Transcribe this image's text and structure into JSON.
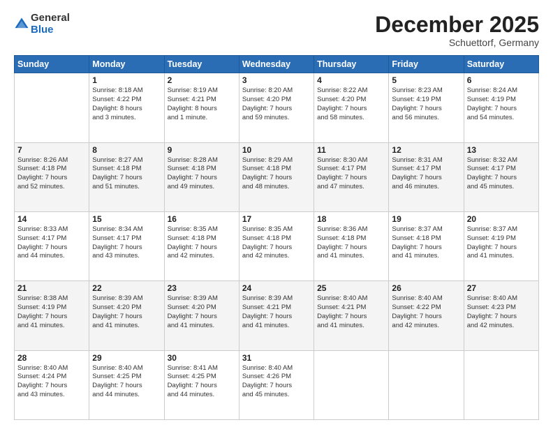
{
  "logo": {
    "general": "General",
    "blue": "Blue"
  },
  "header": {
    "month": "December 2025",
    "location": "Schuettorf, Germany"
  },
  "days_of_week": [
    "Sunday",
    "Monday",
    "Tuesday",
    "Wednesday",
    "Thursday",
    "Friday",
    "Saturday"
  ],
  "weeks": [
    [
      {
        "day": "",
        "info": ""
      },
      {
        "day": "1",
        "info": "Sunrise: 8:18 AM\nSunset: 4:22 PM\nDaylight: 8 hours\nand 3 minutes."
      },
      {
        "day": "2",
        "info": "Sunrise: 8:19 AM\nSunset: 4:21 PM\nDaylight: 8 hours\nand 1 minute."
      },
      {
        "day": "3",
        "info": "Sunrise: 8:20 AM\nSunset: 4:20 PM\nDaylight: 7 hours\nand 59 minutes."
      },
      {
        "day": "4",
        "info": "Sunrise: 8:22 AM\nSunset: 4:20 PM\nDaylight: 7 hours\nand 58 minutes."
      },
      {
        "day": "5",
        "info": "Sunrise: 8:23 AM\nSunset: 4:19 PM\nDaylight: 7 hours\nand 56 minutes."
      },
      {
        "day": "6",
        "info": "Sunrise: 8:24 AM\nSunset: 4:19 PM\nDaylight: 7 hours\nand 54 minutes."
      }
    ],
    [
      {
        "day": "7",
        "info": "Sunrise: 8:26 AM\nSunset: 4:18 PM\nDaylight: 7 hours\nand 52 minutes."
      },
      {
        "day": "8",
        "info": "Sunrise: 8:27 AM\nSunset: 4:18 PM\nDaylight: 7 hours\nand 51 minutes."
      },
      {
        "day": "9",
        "info": "Sunrise: 8:28 AM\nSunset: 4:18 PM\nDaylight: 7 hours\nand 49 minutes."
      },
      {
        "day": "10",
        "info": "Sunrise: 8:29 AM\nSunset: 4:18 PM\nDaylight: 7 hours\nand 48 minutes."
      },
      {
        "day": "11",
        "info": "Sunrise: 8:30 AM\nSunset: 4:17 PM\nDaylight: 7 hours\nand 47 minutes."
      },
      {
        "day": "12",
        "info": "Sunrise: 8:31 AM\nSunset: 4:17 PM\nDaylight: 7 hours\nand 46 minutes."
      },
      {
        "day": "13",
        "info": "Sunrise: 8:32 AM\nSunset: 4:17 PM\nDaylight: 7 hours\nand 45 minutes."
      }
    ],
    [
      {
        "day": "14",
        "info": "Sunrise: 8:33 AM\nSunset: 4:17 PM\nDaylight: 7 hours\nand 44 minutes."
      },
      {
        "day": "15",
        "info": "Sunrise: 8:34 AM\nSunset: 4:17 PM\nDaylight: 7 hours\nand 43 minutes."
      },
      {
        "day": "16",
        "info": "Sunrise: 8:35 AM\nSunset: 4:18 PM\nDaylight: 7 hours\nand 42 minutes."
      },
      {
        "day": "17",
        "info": "Sunrise: 8:35 AM\nSunset: 4:18 PM\nDaylight: 7 hours\nand 42 minutes."
      },
      {
        "day": "18",
        "info": "Sunrise: 8:36 AM\nSunset: 4:18 PM\nDaylight: 7 hours\nand 41 minutes."
      },
      {
        "day": "19",
        "info": "Sunrise: 8:37 AM\nSunset: 4:18 PM\nDaylight: 7 hours\nand 41 minutes."
      },
      {
        "day": "20",
        "info": "Sunrise: 8:37 AM\nSunset: 4:19 PM\nDaylight: 7 hours\nand 41 minutes."
      }
    ],
    [
      {
        "day": "21",
        "info": "Sunrise: 8:38 AM\nSunset: 4:19 PM\nDaylight: 7 hours\nand 41 minutes."
      },
      {
        "day": "22",
        "info": "Sunrise: 8:39 AM\nSunset: 4:20 PM\nDaylight: 7 hours\nand 41 minutes."
      },
      {
        "day": "23",
        "info": "Sunrise: 8:39 AM\nSunset: 4:20 PM\nDaylight: 7 hours\nand 41 minutes."
      },
      {
        "day": "24",
        "info": "Sunrise: 8:39 AM\nSunset: 4:21 PM\nDaylight: 7 hours\nand 41 minutes."
      },
      {
        "day": "25",
        "info": "Sunrise: 8:40 AM\nSunset: 4:21 PM\nDaylight: 7 hours\nand 41 minutes."
      },
      {
        "day": "26",
        "info": "Sunrise: 8:40 AM\nSunset: 4:22 PM\nDaylight: 7 hours\nand 42 minutes."
      },
      {
        "day": "27",
        "info": "Sunrise: 8:40 AM\nSunset: 4:23 PM\nDaylight: 7 hours\nand 42 minutes."
      }
    ],
    [
      {
        "day": "28",
        "info": "Sunrise: 8:40 AM\nSunset: 4:24 PM\nDaylight: 7 hours\nand 43 minutes."
      },
      {
        "day": "29",
        "info": "Sunrise: 8:40 AM\nSunset: 4:25 PM\nDaylight: 7 hours\nand 44 minutes."
      },
      {
        "day": "30",
        "info": "Sunrise: 8:41 AM\nSunset: 4:25 PM\nDaylight: 7 hours\nand 44 minutes."
      },
      {
        "day": "31",
        "info": "Sunrise: 8:40 AM\nSunset: 4:26 PM\nDaylight: 7 hours\nand 45 minutes."
      },
      {
        "day": "",
        "info": ""
      },
      {
        "day": "",
        "info": ""
      },
      {
        "day": "",
        "info": ""
      }
    ]
  ]
}
